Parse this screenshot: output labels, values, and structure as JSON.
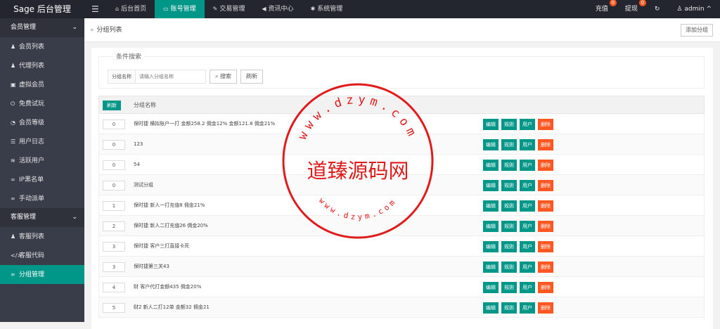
{
  "app": {
    "title": "Sage 后台管理",
    "menu_toggle": "☰"
  },
  "nav": [
    {
      "label": "后台首页",
      "icon": "home-icon",
      "glyph": "⌂",
      "active": false
    },
    {
      "label": "账号管理",
      "icon": "id-card-icon",
      "glyph": "▭",
      "active": true
    },
    {
      "label": "交易管理",
      "icon": "wrench-icon",
      "glyph": "✎",
      "active": false
    },
    {
      "label": "资讯中心",
      "icon": "bullhorn-icon",
      "glyph": "◀",
      "active": false
    },
    {
      "label": "系统管理",
      "icon": "gears-icon",
      "glyph": "✱",
      "active": false
    }
  ],
  "topright": {
    "recharge": "充值",
    "recharge_count": "0",
    "withdraw": "提现",
    "withdraw_count": "0",
    "refresh_glyph": "↻",
    "user": "admin",
    "user_glyph": "♙",
    "caret": "^"
  },
  "sidebar": {
    "group1": {
      "label": "会员管理",
      "chevron": "⌄"
    },
    "group1_items": [
      {
        "label": "会员列表",
        "icon": "user-icon",
        "glyph": "♟"
      },
      {
        "label": "代理列表",
        "icon": "users-icon",
        "glyph": "♟"
      },
      {
        "label": "虚拟会员",
        "icon": "lock-icon",
        "glyph": "▣"
      },
      {
        "label": "免费试玩",
        "icon": "power-icon",
        "glyph": "⏻"
      },
      {
        "label": "会员等级",
        "icon": "dashboard-icon",
        "glyph": "◔"
      },
      {
        "label": "用户日志",
        "icon": "log-icon",
        "glyph": "☰"
      },
      {
        "label": "活跃用户",
        "icon": "wifi-icon",
        "glyph": "≋"
      },
      {
        "label": "IP黑名单",
        "icon": "link-icon",
        "glyph": "∞"
      },
      {
        "label": "手动派单",
        "icon": "link-icon",
        "glyph": "∞"
      }
    ],
    "group2": {
      "label": "客服管理",
      "chevron": "⌄"
    },
    "group2_items": [
      {
        "label": "客服列表",
        "icon": "user-icon",
        "glyph": "♟",
        "active": false
      },
      {
        "label": "客服代码",
        "icon": "code-icon",
        "glyph": "</>",
        "active": false
      },
      {
        "label": "分组管理",
        "icon": "link-icon",
        "glyph": "∞",
        "active": true
      }
    ]
  },
  "breadcrumb": {
    "sep": "»",
    "label": "分组列表"
  },
  "add_button": "添加分组",
  "filter": {
    "title": "条件搜索",
    "label": "分组名称",
    "placeholder": "请输入分组名称",
    "search": "搜索",
    "search_glyph": "⌕",
    "reset": "刷新"
  },
  "table": {
    "refresh": "刷新",
    "header_name": "分组名称",
    "actions": {
      "edit": "编辑",
      "rules": "规则",
      "users": "用户",
      "delete": "删除"
    },
    "rows": [
      {
        "sort": "0",
        "name": "保时捷 横拟账户一打 金额258.2 佣金12% 金额121.8 佣金21%"
      },
      {
        "sort": "0",
        "name": "123"
      },
      {
        "sort": "0",
        "name": "54"
      },
      {
        "sort": "0",
        "name": "测试分组"
      },
      {
        "sort": "1",
        "name": "保时捷 新人一打充值8 佣金21%"
      },
      {
        "sort": "2",
        "name": "保时捷 新人二打充值26 佣金20%"
      },
      {
        "sort": "3",
        "name": "保时捷 客户三打直接卡死"
      },
      {
        "sort": "3",
        "name": "保时捷第三关43"
      },
      {
        "sort": "4",
        "name": "财 客户代打金额435 佣金20%"
      },
      {
        "sort": "5",
        "name": "财2 新人二打12单 金额32 佣金21"
      }
    ]
  },
  "watermark": {
    "main": "道臻源码网",
    "top_text": "www.dzym.com",
    "bottom_text": "www.dzym.com",
    "color": "#e01b1b"
  },
  "colors": {
    "accent": "#009688",
    "danger": "#ff5722",
    "topbar": "#23262e",
    "sidebar": "#393d49"
  }
}
